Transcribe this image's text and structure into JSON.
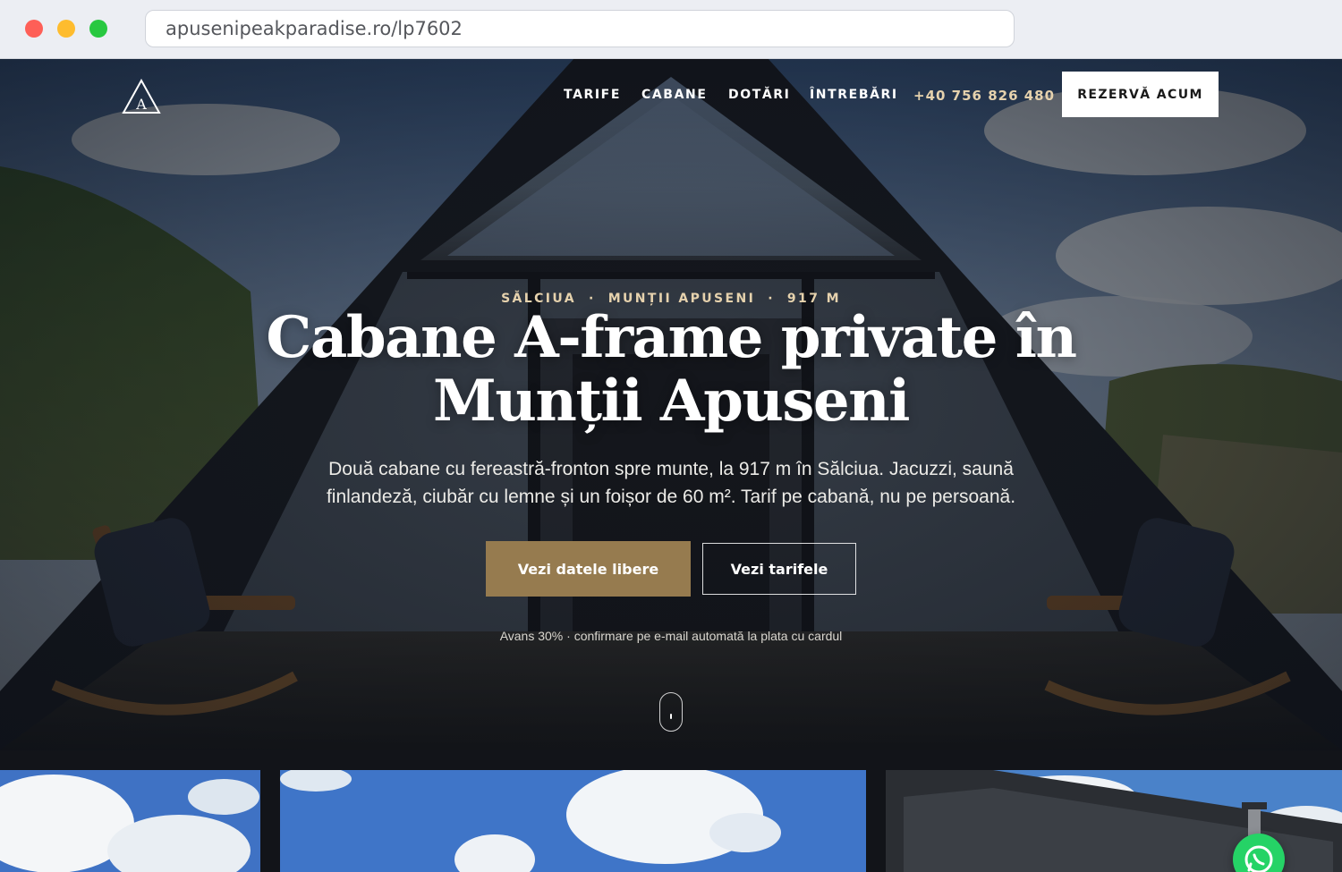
{
  "browser": {
    "url": "apusenipeakparadise.ro/lp7602"
  },
  "header": {
    "logo_letter": "A",
    "nav": [
      {
        "label": "TARIFE"
      },
      {
        "label": "CABANE"
      },
      {
        "label": "DOTĂRI"
      },
      {
        "label": "ÎNTREBĂRI"
      }
    ],
    "phone": "+40 756 826 480",
    "book_label": "REZERVĂ ACUM"
  },
  "hero": {
    "eyebrow": [
      "SĂLCIUA",
      "MUNȚII APUSENI",
      "917 M"
    ],
    "eyebrow_separator": "·",
    "title_line1": "Cabane A-frame private în",
    "title_line2": "Munții Apuseni",
    "lead": "Două cabane cu fereastră-fronton spre munte, la 917 m în Sălciua. Jacuzzi, saună finlandeză, ciubăr cu lemne și un foișor de 60 m². Tarif pe cabană, nu pe persoană.",
    "primary_cta": "Vezi datele libere",
    "secondary_cta": "Vezi tarifele",
    "note": "Avans 30% · confirmare pe e-mail automată la plata cu cardul"
  },
  "colors": {
    "accent_gold": "#967b4f",
    "eyebrow_gold": "#e6d2ad",
    "whatsapp_green": "#25d366"
  },
  "icons": {
    "logo": "a-frame-logo-icon",
    "scroll": "mouse-scroll-icon",
    "chat": "whatsapp-icon"
  }
}
